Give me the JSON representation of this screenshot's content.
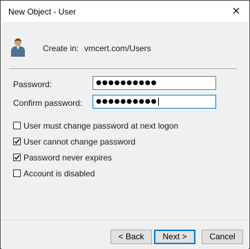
{
  "window": {
    "title": "New Object - User",
    "close_glyph": "✕"
  },
  "header": {
    "create_in_label": "Create in:",
    "create_in_value": "vmcert.com/Users",
    "icon": "user-icon"
  },
  "form": {
    "password_label": "Password:",
    "password_value": "●●●●●●●●●●",
    "confirm_label": "Confirm password:",
    "confirm_value": "●●●●●●●●●●"
  },
  "options": [
    {
      "label": "User must change password at next logon",
      "checked": false
    },
    {
      "label": "User cannot change password",
      "checked": true
    },
    {
      "label": "Password never expires",
      "checked": true
    },
    {
      "label": "Account is disabled",
      "checked": false
    }
  ],
  "buttons": {
    "back": "< Back",
    "next": "Next >",
    "cancel": "Cancel"
  },
  "colors": {
    "accent": "#0078d7",
    "panel": "#f0f0f0"
  }
}
